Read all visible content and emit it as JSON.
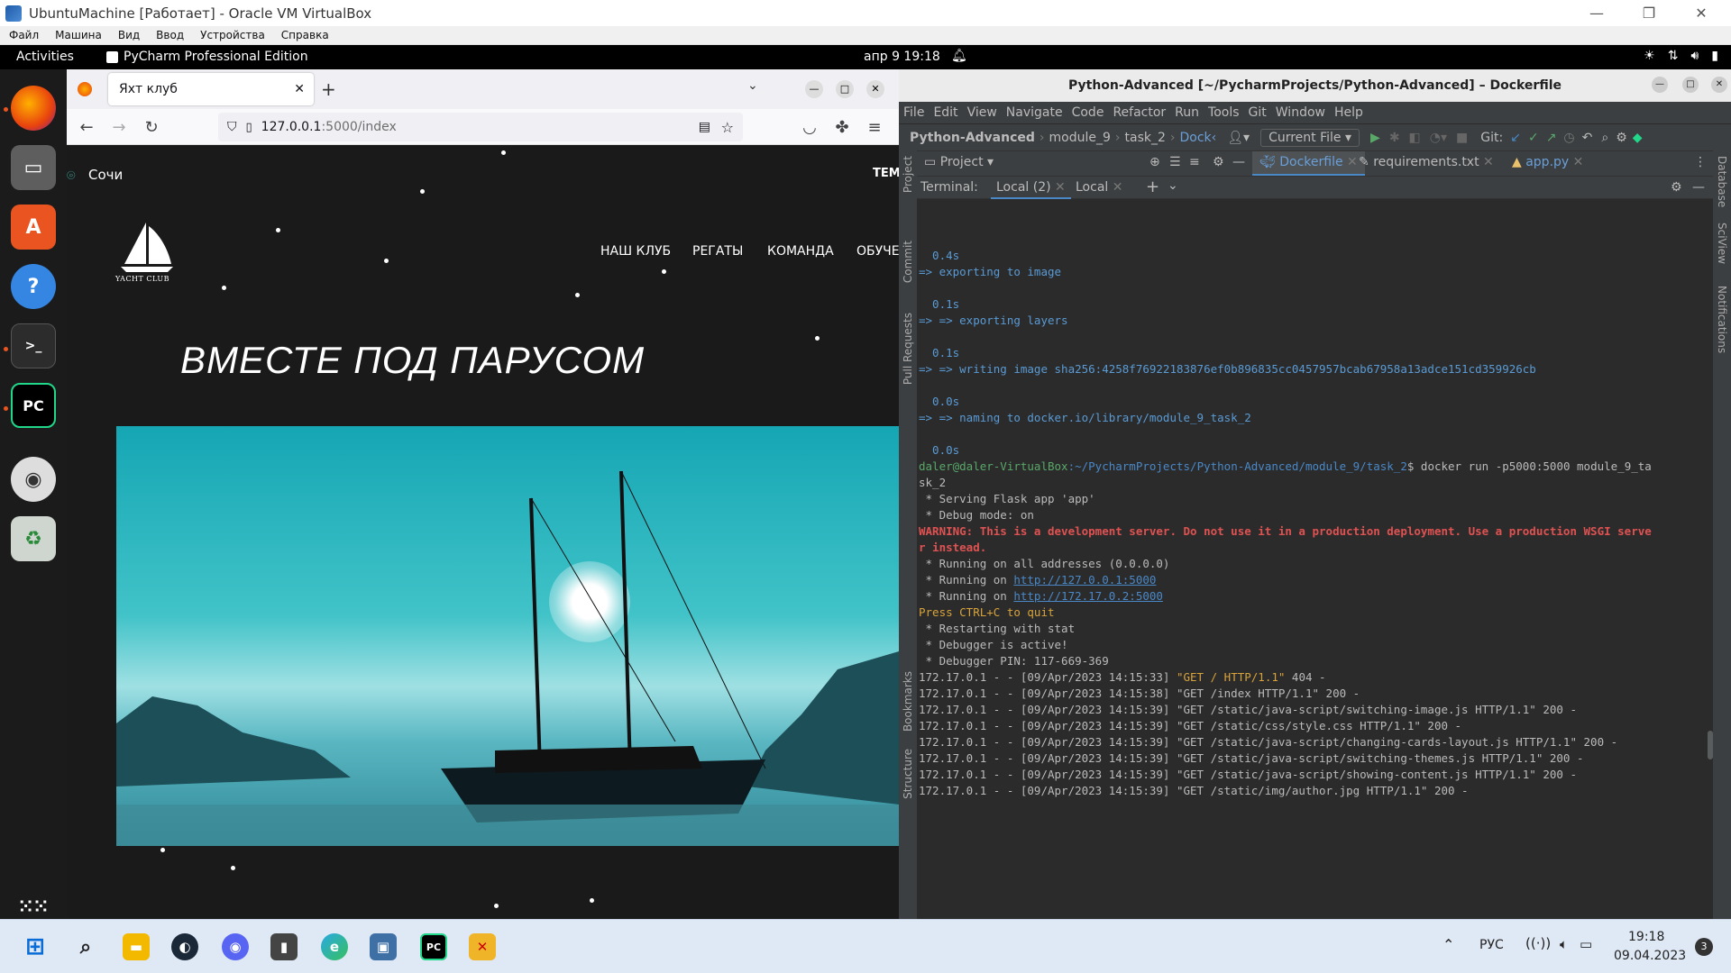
{
  "vbox": {
    "title": "UbuntuMachine [Работает] - Oracle VM VirtualBox",
    "menu": [
      "Файл",
      "Машина",
      "Вид",
      "Ввод",
      "Устройства",
      "Справка"
    ],
    "min": "—",
    "restore": "❐",
    "close": "✕"
  },
  "gnome": {
    "activities": "Activities",
    "app_name": "PyCharm Professional Edition",
    "clock": "апр 9  19:18"
  },
  "firefox": {
    "tab_title": "Яхт клуб",
    "url_host": "127.0.0.1",
    "url_path": ":5000/index"
  },
  "site": {
    "city": "Сочи",
    "top_right": "ТЕМА",
    "logo_text": "YACHT CLUB",
    "nav": [
      "НАШ КЛУБ",
      "РЕГАТЫ",
      "КОМАНДА",
      "ОБУЧЕ"
    ],
    "hero": "ВМЕСТЕ ПОД ПАРУСОМ"
  },
  "pycharm": {
    "title": "Python-Advanced [~/PycharmProjects/Python-Advanced] – Dockerfile",
    "menu": [
      "File",
      "Edit",
      "View",
      "Navigate",
      "Code",
      "Refactor",
      "Run",
      "Tools",
      "Git",
      "Window",
      "Help"
    ],
    "breadcrumb": [
      "Python-Advanced",
      "module_9",
      "task_2",
      "Dock‹"
    ],
    "run_config": "Current File",
    "git_label": "Git:",
    "project_tab": "Project",
    "editor_tabs": [
      "Dockerfile",
      "requirements.txt",
      "app.py"
    ],
    "terminal_label": "Terminal:",
    "term_tabs": [
      "Local (2)",
      "Local"
    ],
    "left_tools": [
      "Project",
      "Commit",
      "Pull Requests",
      "Bookmarks",
      "Structure"
    ],
    "right_tools": [
      "Database",
      "SciView",
      "Notifications"
    ]
  },
  "terminal": {
    "lines": [
      {
        "t": "  0.4s",
        "c": "#5a9bd5"
      },
      {
        "t": "=> exporting to image",
        "c": "#5a9bd5"
      },
      {
        "t": "",
        "c": "#bbb"
      },
      {
        "t": "  0.1s",
        "c": "#5a9bd5"
      },
      {
        "t": "=> => exporting layers",
        "c": "#5a9bd5"
      },
      {
        "t": "",
        "c": "#bbb"
      },
      {
        "t": "  0.1s",
        "c": "#5a9bd5"
      },
      {
        "t": "=> => writing image sha256:4258f76922183876ef0b896835cc0457957bcab67958a13adce151cd359926cb",
        "c": "#5a9bd5"
      },
      {
        "t": "",
        "c": "#bbb"
      },
      {
        "t": "  0.0s",
        "c": "#5a9bd5"
      },
      {
        "t": "=> => naming to docker.io/library/module_9_task_2",
        "c": "#5a9bd5"
      },
      {
        "t": "",
        "c": "#bbb"
      },
      {
        "t": "  0.0s",
        "c": "#5a9bd5"
      }
    ],
    "prompt_user": "daler@daler-VirtualBox",
    "prompt_path": ":~/PycharmProjects/Python-Advanced/module_9/task_2",
    "prompt_cmd": "$ docker run -p5000:5000 module_9_ta",
    "prompt_cmd2": "sk_2",
    "flask": [
      {
        "t": " * Serving Flask app 'app'",
        "c": "#bbb"
      },
      {
        "t": " * Debug mode: on",
        "c": "#bbb"
      },
      {
        "t": "WARNING: This is a development server. Do not use it in a production deployment. Use a production WSGI serve",
        "c": "#e05252",
        "b": true
      },
      {
        "t": "r instead.",
        "c": "#e05252",
        "b": true
      },
      {
        "t": " * Running on all addresses (0.0.0.0)",
        "c": "#bbb"
      }
    ],
    "running1_pre": " * Running on ",
    "running1_url": "http://127.0.0.1:5000",
    "running2_pre": " * Running on ",
    "running2_url": "http://172.17.0.2:5000",
    "quit": "Press CTRL+C to quit",
    "after": [
      " * Restarting with stat",
      " * Debugger is active!",
      " * Debugger PIN: 117-669-369"
    ],
    "log_first_pre": "172.17.0.1 - - [09/Apr/2023 14:15:33] ",
    "log_first_req": "\"GET / HTTP/1.1\"",
    "log_first_post": " 404 -",
    "logs": [
      "172.17.0.1 - - [09/Apr/2023 14:15:38] \"GET /index HTTP/1.1\" 200 -",
      "172.17.0.1 - - [09/Apr/2023 14:15:39] \"GET /static/java-script/switching-image.js HTTP/1.1\" 200 -",
      "172.17.0.1 - - [09/Apr/2023 14:15:39] \"GET /static/css/style.css HTTP/1.1\" 200 -",
      "172.17.0.1 - - [09/Apr/2023 14:15:39] \"GET /static/java-script/changing-cards-layout.js HTTP/1.1\" 200 -",
      "172.17.0.1 - - [09/Apr/2023 14:15:39] \"GET /static/java-script/switching-themes.js HTTP/1.1\" 200 -",
      "172.17.0.1 - - [09/Apr/2023 14:15:39] \"GET /static/java-script/showing-content.js HTTP/1.1\" 200 -",
      "172.17.0.1 - - [09/Apr/2023 14:15:39] \"GET /static/img/author.jpg HTTP/1.1\" 200 -"
    ]
  },
  "taskbar": {
    "lang": "РУС",
    "time": "19:18",
    "date": "09.04.2023",
    "badge": "3"
  }
}
